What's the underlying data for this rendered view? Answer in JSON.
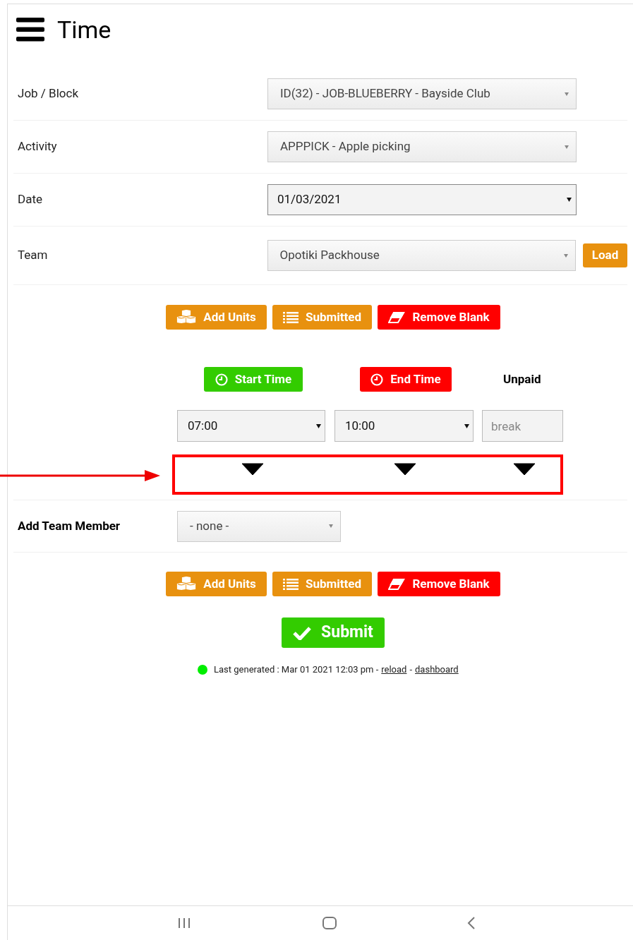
{
  "title": "Time",
  "fields": [
    {
      "label": "Job / Block",
      "value": "ID(32) - JOB-BLUEBERRY - Bayside Club",
      "kind": "select"
    },
    {
      "label": "Activity",
      "value": "APPPICK - Apple picking",
      "kind": "select"
    },
    {
      "label": "Date",
      "value": "01/03/2021",
      "kind": "date"
    },
    {
      "label": "Team",
      "value": "Opotiki Packhouse",
      "kind": "select",
      "action": "Load"
    }
  ],
  "action_buttons": [
    {
      "label": "Add Units",
      "kind": "units"
    },
    {
      "label": "Submitted",
      "kind": "list"
    },
    {
      "label": "Remove Blank",
      "kind": "remove"
    }
  ],
  "time": {
    "start_button": "Start Time",
    "end_button": "End Time",
    "unpaid_label": "Unpaid",
    "start_value": "07:00",
    "end_value": "10:00",
    "break_placeholder": "break"
  },
  "team_member": {
    "label": "Add Team Member",
    "value": "- none -"
  },
  "action_buttons_bottom": [
    {
      "label": "Add Units",
      "kind": "units"
    },
    {
      "label": "Submitted",
      "kind": "list"
    },
    {
      "label": "Remove Blank",
      "kind": "remove"
    }
  ],
  "submit": "Submit",
  "status": {
    "text": "Last generated : Mar 01 2021 12:03 pm -",
    "reload_link": "reload",
    "separator": "-",
    "dashboard_link": "dashboard"
  }
}
